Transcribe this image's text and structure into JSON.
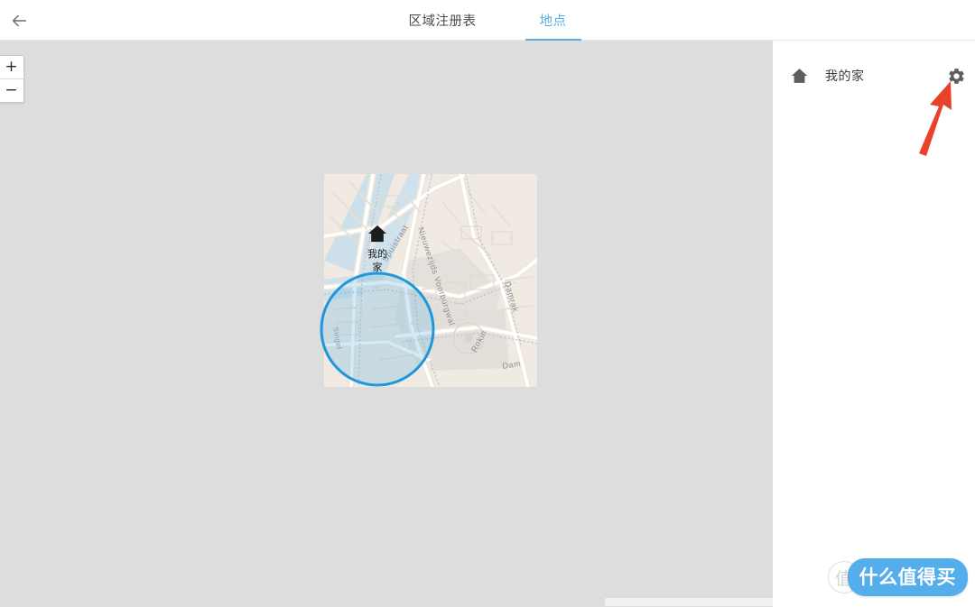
{
  "header": {
    "back_icon": "arrow-left-icon",
    "tabs": [
      {
        "label": "区域注册表",
        "active": false
      },
      {
        "label": "地点",
        "active": true
      }
    ],
    "active_tab_color": "#5aade0"
  },
  "map": {
    "background_color": "#dddddd",
    "zoom_controls": {
      "zoom_in_label": "+",
      "zoom_out_label": "−"
    },
    "geofence": {
      "label": "我的家",
      "marker_icon": "home-icon",
      "stroke_color": "#2196d9",
      "fill_color": "rgba(96,180,225,0.28)"
    },
    "street_labels": [
      "Spuistraat",
      "Nieuwezijds Voorburgwal",
      "Damrak",
      "Rokin",
      "Dam",
      "Singel"
    ]
  },
  "side_panel": {
    "place": {
      "home_icon": "home-icon",
      "name": "我的家",
      "settings_icon": "gear-icon"
    }
  },
  "annotation": {
    "arrow_color": "#e8432a",
    "points_to": "gear-icon"
  },
  "watermark": {
    "logo_text": "值",
    "brand_text": "什么值得买",
    "brand_color": "#54aeec"
  }
}
